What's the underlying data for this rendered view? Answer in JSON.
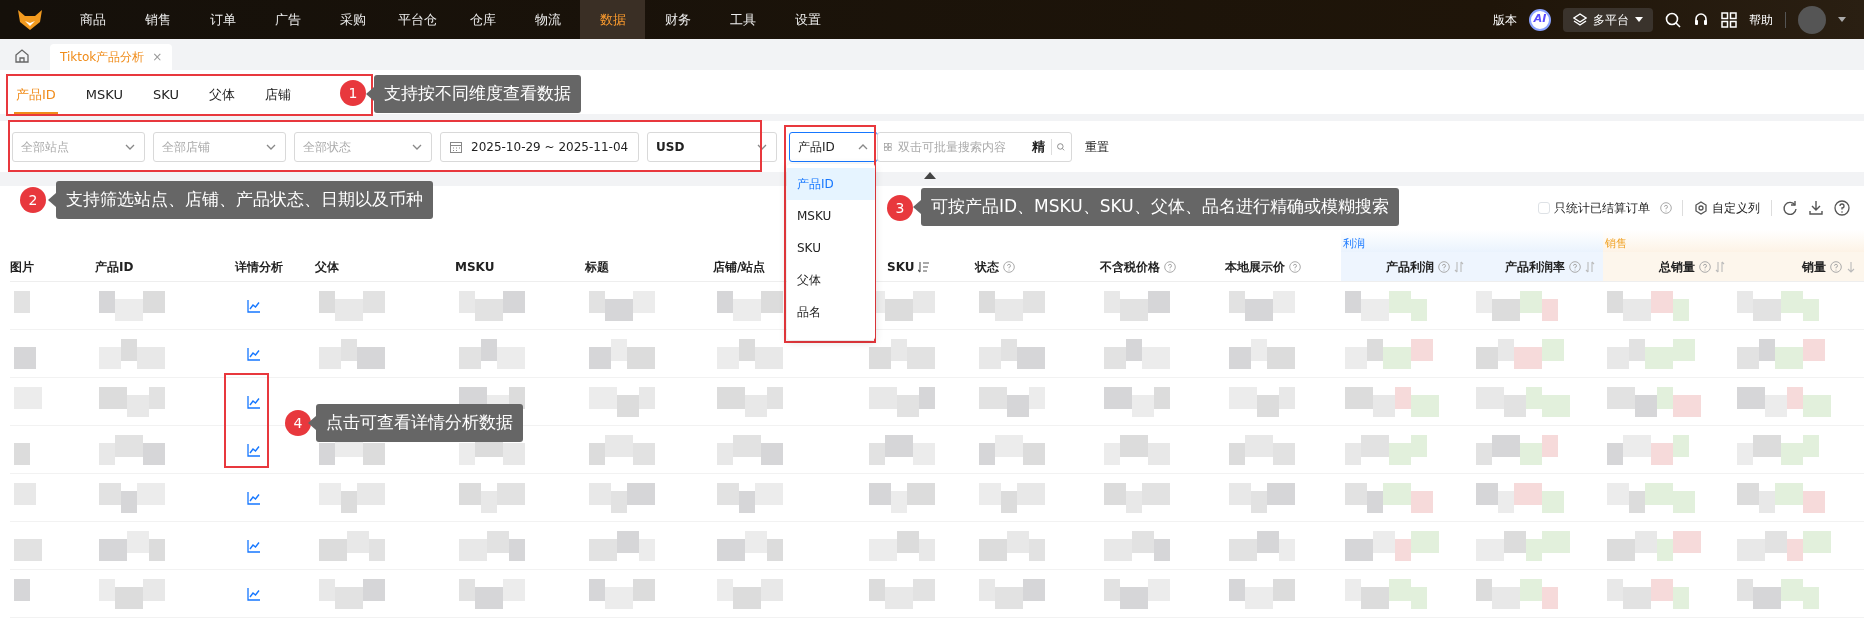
{
  "nav": {
    "items": [
      {
        "label": "商品",
        "selected": false
      },
      {
        "label": "销售",
        "selected": false
      },
      {
        "label": "订单",
        "selected": false
      },
      {
        "label": "广告",
        "selected": false
      },
      {
        "label": "采购",
        "selected": false
      },
      {
        "label": "平台仓",
        "selected": false
      },
      {
        "label": "仓库",
        "selected": false
      },
      {
        "label": "物流",
        "selected": false
      },
      {
        "label": "数据",
        "selected": true
      },
      {
        "label": "财务",
        "selected": false
      },
      {
        "label": "工具",
        "selected": false
      },
      {
        "label": "设置",
        "selected": false
      }
    ],
    "version": "版本",
    "ai": "AI",
    "platform": "多平台",
    "help": "帮助"
  },
  "page_tabs": [
    {
      "label": "Tiktok产品分析",
      "close": "×",
      "selected": true
    }
  ],
  "dimension_tabs": [
    {
      "label": "产品ID",
      "selected": true
    },
    {
      "label": "MSKU",
      "selected": false
    },
    {
      "label": "SKU",
      "selected": false
    },
    {
      "label": "父体",
      "selected": false
    },
    {
      "label": "店铺",
      "selected": false
    }
  ],
  "filters": [
    {
      "kind": "select",
      "placeholder": "全部站点"
    },
    {
      "kind": "select",
      "placeholder": "全部店铺"
    },
    {
      "kind": "select",
      "placeholder": "全部状态"
    },
    {
      "kind": "date",
      "value": "2025-10-29 ~ 2025-11-04"
    },
    {
      "kind": "select",
      "value": "USD"
    }
  ],
  "search": {
    "type": "产品ID",
    "expanded": true,
    "options": [
      {
        "label": "产品ID",
        "selected": true
      },
      {
        "label": "MSKU",
        "selected": false
      },
      {
        "label": "SKU",
        "selected": false
      },
      {
        "label": "父体",
        "selected": false
      },
      {
        "label": "品名",
        "selected": false
      }
    ],
    "placeholder": "双击可批量搜索内容",
    "exact": "精",
    "reset": "重置"
  },
  "toolbar": {
    "settled_only": {
      "label": "只统计已结算订单",
      "checked": false
    },
    "custom_columns": "自定义列"
  },
  "columns": [
    {
      "label": "图片",
      "help": false,
      "kind": "plain"
    },
    {
      "label": "产品ID",
      "help": false,
      "kind": "plain"
    },
    {
      "label": "详情分析",
      "help": false,
      "kind": "plain"
    },
    {
      "label": "父体",
      "help": false,
      "kind": "plain"
    },
    {
      "label": "MSKU",
      "help": false,
      "kind": "plain"
    },
    {
      "label": "标题",
      "help": false,
      "kind": "plain"
    },
    {
      "label": "店铺/站点",
      "help": false,
      "kind": "plain"
    },
    {
      "label": "SKU",
      "help": false,
      "kind": "listed"
    },
    {
      "label": "状态",
      "help": true,
      "kind": "plain"
    },
    {
      "label": "不含税价格",
      "help": true,
      "kind": "plain"
    },
    {
      "label": "本地展示价",
      "help": true,
      "kind": "plain"
    }
  ],
  "column_groups": [
    {
      "label": "利润",
      "kind": "profit",
      "columns": [
        {
          "label": "产品利润",
          "help": true,
          "kind": "sortable"
        },
        {
          "label": "产品利润率",
          "help": true,
          "kind": "sortable"
        }
      ]
    },
    {
      "label": "销售",
      "kind": "sales",
      "columns": [
        {
          "label": "总销量",
          "help": true,
          "kind": "sortable"
        },
        {
          "label": "销量",
          "help": true,
          "kind": "sorted"
        }
      ]
    }
  ],
  "rows": [
    {
      "kind": "redacted"
    },
    {
      "kind": "redacted"
    },
    {
      "kind": "redacted"
    },
    {
      "kind": "redacted"
    },
    {
      "kind": "redacted"
    },
    {
      "kind": "redacted"
    },
    {
      "kind": "redacted"
    }
  ],
  "annotations": [
    {
      "number": "1",
      "text": "支持按不同维度查看数据"
    },
    {
      "number": "2",
      "text": "支持筛选站点、店铺、产品状态、日期以及币种"
    },
    {
      "number": "3",
      "text": "可按产品ID、MSKU、SKU、父体、品名进行精确或模糊搜索"
    },
    {
      "number": "4",
      "text": "点击可查看详情分析数据"
    }
  ]
}
